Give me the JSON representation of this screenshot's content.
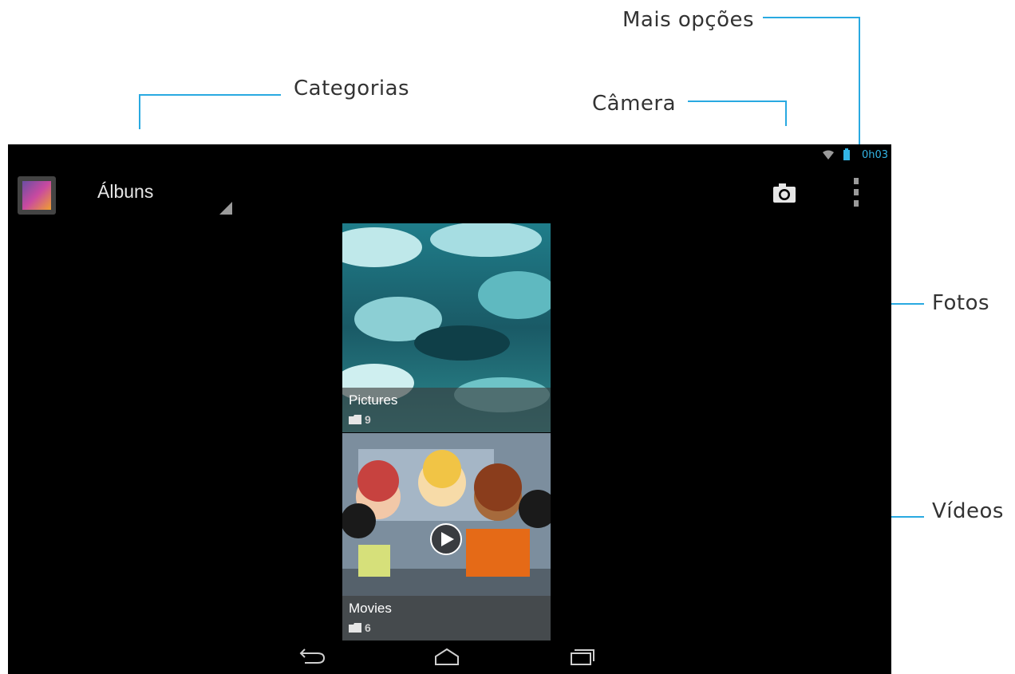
{
  "callouts": {
    "mais_opcoes": "Mais opções",
    "categorias": "Categorias",
    "camera": "Câmera",
    "fotos": "Fotos",
    "videos": "Vídeos"
  },
  "status_bar": {
    "time": "0h03"
  },
  "action_bar": {
    "title": "Álbuns",
    "icons": [
      "gallery-app-icon",
      "camera-icon",
      "overflow-menu-icon"
    ]
  },
  "albums": [
    {
      "name": "Pictures",
      "count": "9"
    },
    {
      "name": "Movies",
      "count": "6"
    }
  ],
  "nav_bar": {
    "icons": [
      "back-icon",
      "home-icon",
      "recent-apps-icon"
    ]
  },
  "colors": {
    "accent": "#29a9e1",
    "status_accent": "#33b5e5",
    "screen_bg": "#000000"
  }
}
